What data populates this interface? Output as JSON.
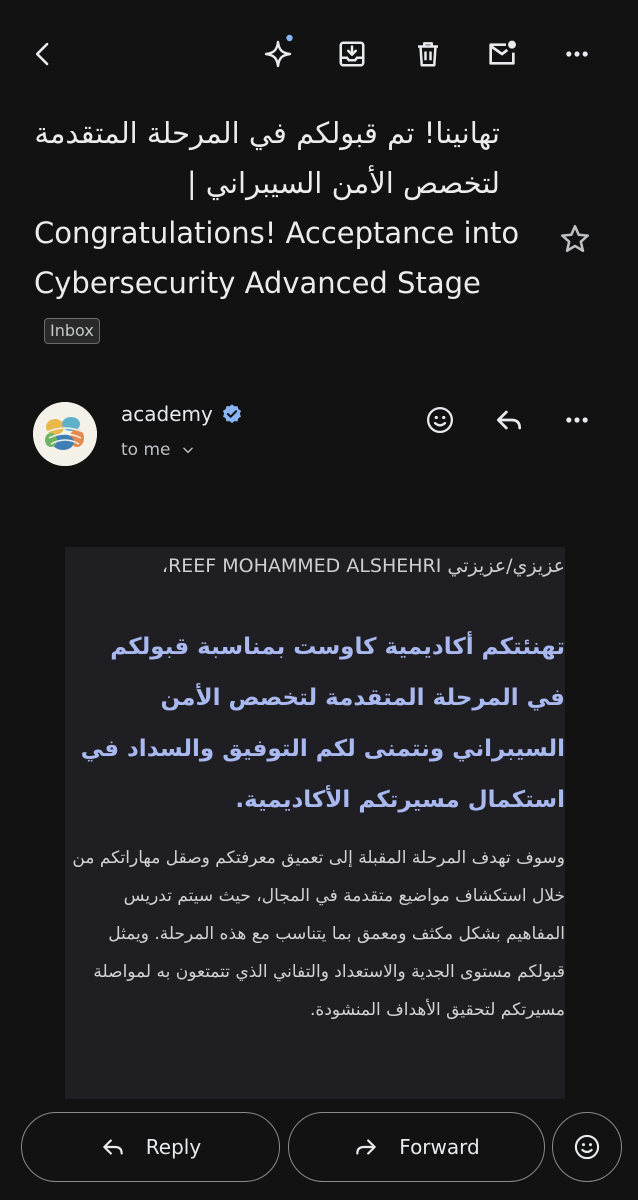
{
  "subject": {
    "line1": "تهانينا! تم قبولكم في المرحلة المتقدمة",
    "line2": "لتخصص الأمن السيبراني |",
    "english": "Congratulations! Acceptance into Cybersecurity Advanced Stage",
    "label": "Inbox"
  },
  "sender": {
    "name": "academy",
    "recipient": "to me"
  },
  "body": {
    "greeting": "عزيزي/عزيزتي REEF MOHAMMED ALSHEHRI،",
    "lead": "تهنئتكم أكاديمية كاوست بمناسبة قبولكم في المرحلة المتقدمة لتخصص الأمن السيبراني ونتمنى لكم التوفيق والسداد في استكمال مسيرتكم الأكاديمية.",
    "paragraph": "وسوف تهدف المرحلة المقبلة إلى تعميق معرفتكم وصقل مهاراتكم من خلال استكشاف مواضيع متقدمة في المجال، حيث سيتم تدريس المفاهيم بشكل مكثف ومعمق بما يتناسب مع هذه المرحلة. ويمثل قبولكم مستوى الجدية والاستعداد والتفاني الذي تتمتعون به لمواصلة مسيرتكم لتحقيق الأهداف المنشودة."
  },
  "actions": {
    "reply": "Reply",
    "forward": "Forward"
  },
  "icons": {
    "back": "back-arrow-icon",
    "gemini": "sparkle-icon",
    "archive": "archive-icon",
    "delete": "trash-icon",
    "unread": "mark-unread-icon",
    "more": "more-vert-icon",
    "star": "star-icon",
    "verified": "verified-badge-icon",
    "emoji": "emoji-icon",
    "reply": "reply-icon",
    "forward": "forward-icon"
  },
  "colors": {
    "background": "#121212",
    "lead_text": "#a9b9f0",
    "verified": "#8ab4f8",
    "body_box": "#1f1f23"
  }
}
